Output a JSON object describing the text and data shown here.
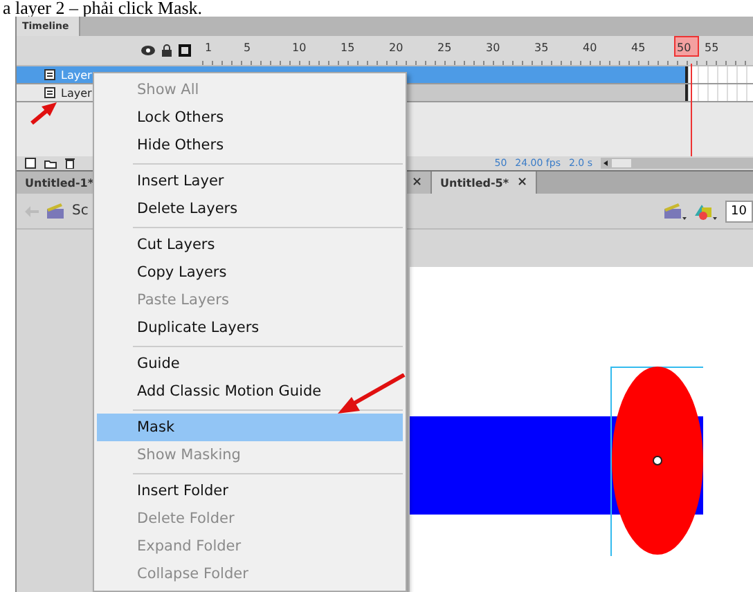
{
  "caption": "a layer 2 – phải click Mask.",
  "timeline": {
    "tab": "Timeline",
    "frames": [
      {
        "label": "1",
        "current": false
      },
      {
        "label": "5",
        "current": false
      },
      {
        "label": "10",
        "current": false
      },
      {
        "label": "15",
        "current": false
      },
      {
        "label": "20",
        "current": false
      },
      {
        "label": "25",
        "current": false
      },
      {
        "label": "30",
        "current": false
      },
      {
        "label": "35",
        "current": false
      },
      {
        "label": "40",
        "current": false
      },
      {
        "label": "45",
        "current": false
      },
      {
        "label": "50",
        "current": true
      },
      {
        "label": "55",
        "current": false
      }
    ],
    "layers": [
      {
        "name": "Layer",
        "selected": true
      },
      {
        "name": "Layer",
        "selected": false
      }
    ],
    "status": {
      "frame": "50",
      "fps": "24.00 fps",
      "time": "2.0 s"
    }
  },
  "documents": [
    {
      "label": "Untitled-1*",
      "close": "×",
      "selected": false
    },
    {
      "label": "Untitled-5*",
      "close": "×",
      "selected": true
    }
  ],
  "edit_bar": {
    "scene": "Sc",
    "zoom": "10"
  },
  "context_menu": [
    {
      "kind": "item",
      "label": "Show All",
      "disabled": true,
      "selected": false
    },
    {
      "kind": "item",
      "label": "Lock Others",
      "disabled": false,
      "selected": false
    },
    {
      "kind": "item",
      "label": "Hide Others",
      "disabled": false,
      "selected": false
    },
    {
      "kind": "separator"
    },
    {
      "kind": "item",
      "label": "Insert Layer",
      "disabled": false,
      "selected": false
    },
    {
      "kind": "item",
      "label": "Delete Layers",
      "disabled": false,
      "selected": false
    },
    {
      "kind": "separator"
    },
    {
      "kind": "item",
      "label": "Cut Layers",
      "disabled": false,
      "selected": false
    },
    {
      "kind": "item",
      "label": "Copy Layers",
      "disabled": false,
      "selected": false
    },
    {
      "kind": "item",
      "label": "Paste Layers",
      "disabled": true,
      "selected": false
    },
    {
      "kind": "item",
      "label": "Duplicate Layers",
      "disabled": false,
      "selected": false
    },
    {
      "kind": "separator"
    },
    {
      "kind": "item",
      "label": "Guide",
      "disabled": false,
      "selected": false
    },
    {
      "kind": "item",
      "label": "Add Classic Motion Guide",
      "disabled": false,
      "selected": false
    },
    {
      "kind": "separator"
    },
    {
      "kind": "item",
      "label": "Mask",
      "disabled": false,
      "selected": true
    },
    {
      "kind": "item",
      "label": "Show Masking",
      "disabled": true,
      "selected": false
    },
    {
      "kind": "separator"
    },
    {
      "kind": "item",
      "label": "Insert Folder",
      "disabled": false,
      "selected": false
    },
    {
      "kind": "item",
      "label": "Delete Folder",
      "disabled": true,
      "selected": false
    },
    {
      "kind": "item",
      "label": "Expand Folder",
      "disabled": true,
      "selected": false
    },
    {
      "kind": "item",
      "label": "Collapse Folder",
      "disabled": true,
      "selected": false
    }
  ]
}
